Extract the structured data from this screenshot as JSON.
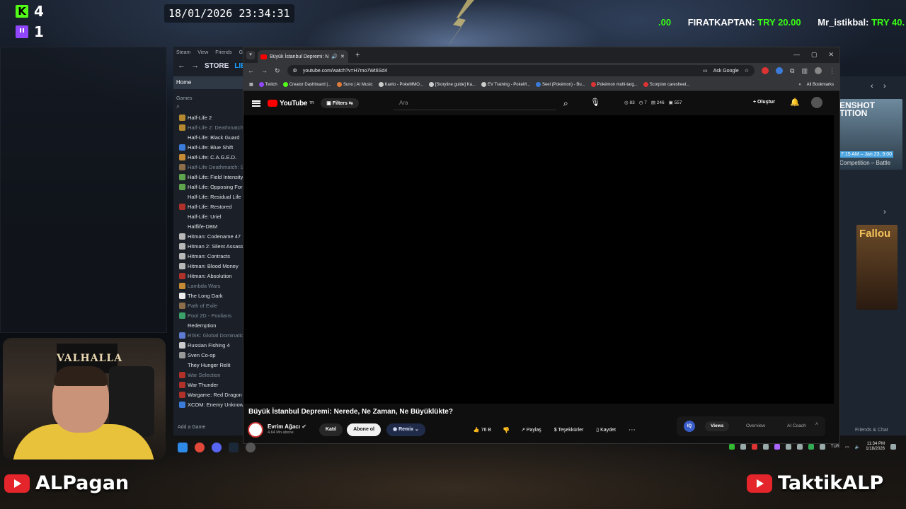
{
  "overlay": {
    "kick_count": "4",
    "twitch_count": "1",
    "clock": "18/01/2026 23:34:31",
    "ticker": [
      {
        "name": "",
        "amount": ".00"
      },
      {
        "name": "FIRATKAPTAN:",
        "amount": "TRY 20.00"
      },
      {
        "name": "Mr_istikbal:",
        "amount": "TRY 40."
      }
    ],
    "channel_left": "ALPagan",
    "channel_right": "TaktikALP",
    "webcam_wall_text": "VALHALLA"
  },
  "steam": {
    "menu": [
      "Steam",
      "View",
      "Friends",
      "G"
    ],
    "nav_store": "STORE",
    "nav_library": "LIBR",
    "home": "Home",
    "games_label": "Games",
    "search_glyph": "⌕",
    "games": [
      {
        "name": "Half-Life 2",
        "dim": false,
        "color": "#b5892f"
      },
      {
        "name": "Half-Life 2: Deathmatch",
        "dim": true,
        "color": "#b5892f"
      },
      {
        "name": "Half-Life: Black Guard",
        "dim": false,
        "color": "#1b2028"
      },
      {
        "name": "Half-Life: Blue Shift",
        "dim": false,
        "color": "#3b7bd9"
      },
      {
        "name": "Half-Life: C.A.G.E.D.",
        "dim": false,
        "color": "#c58a33"
      },
      {
        "name": "Half-Life Deathmatch: S",
        "dim": true,
        "color": "#8d6e4a"
      },
      {
        "name": "Half-Life: Field Intensity",
        "dim": false,
        "color": "#5fa54d"
      },
      {
        "name": "Half-Life: Opposing For",
        "dim": false,
        "color": "#5fa54d"
      },
      {
        "name": "Half-Life: Residual Life",
        "dim": false,
        "color": "#1b2028"
      },
      {
        "name": "Half-Life: Restored",
        "dim": false,
        "color": "#b0302a"
      },
      {
        "name": "Half-Life: Uriel",
        "dim": false,
        "color": "#1b2028"
      },
      {
        "name": "Halflife-DBM",
        "dim": false,
        "color": "#1b2028"
      },
      {
        "name": "Hitman: Codename 47",
        "dim": false,
        "color": "#b8b8b8"
      },
      {
        "name": "Hitman 2: Silent Assass",
        "dim": false,
        "color": "#b8b8b8"
      },
      {
        "name": "Hitman: Contracts",
        "dim": false,
        "color": "#b8b8b8"
      },
      {
        "name": "Hitman: Blood Money",
        "dim": false,
        "color": "#b8b8b8"
      },
      {
        "name": "Hitman: Absolution",
        "dim": false,
        "color": "#b0302a"
      },
      {
        "name": "Lambda Wars",
        "dim": true,
        "color": "#c58a33"
      },
      {
        "name": "The Long Dark",
        "dim": false,
        "color": "#eeeeee"
      },
      {
        "name": "Path of Exile",
        "dim": true,
        "color": "#8d6e4a"
      },
      {
        "name": "Pool 2D - Poolians",
        "dim": true,
        "color": "#3aa06a"
      },
      {
        "name": "Redemption",
        "dim": false,
        "color": "#1b2028"
      },
      {
        "name": "RISK: Global Domination",
        "dim": true,
        "color": "#5c7bd0"
      },
      {
        "name": "Russian Fishing 4",
        "dim": false,
        "color": "#cccccc"
      },
      {
        "name": "Sven Co-op",
        "dim": false,
        "color": "#999999"
      },
      {
        "name": "They Hunger Relit",
        "dim": false,
        "color": "#1b2028"
      },
      {
        "name": "War Selection",
        "dim": true,
        "color": "#b0302a"
      },
      {
        "name": "War Thunder",
        "dim": false,
        "color": "#b0302a"
      },
      {
        "name": "Wargame: Red Dragon",
        "dim": false,
        "color": "#b0302a"
      },
      {
        "name": "XCOM: Enemy Unknown",
        "dim": false,
        "color": "#3b7bd9"
      }
    ],
    "add_game": "Add a Game"
  },
  "store": {
    "card_title": "ENSHOT\nTITION",
    "card_time": "7:15 AM – Jan 23, 9:00",
    "card_sub": "Competition – Battle",
    "fallout": "Fallou",
    "friends_chat": "Friends & Chat"
  },
  "chrome": {
    "tab_title": "Büyük İstanbul Depremi: N",
    "url": "youtube.com/watch?v=H7mo7Wt6Sd4",
    "ask_google": "Ask Google",
    "bookmarks": [
      {
        "label": "Twitch",
        "color": "#9146ff"
      },
      {
        "label": "Creator Dashboard |...",
        "color": "#53fc18"
      },
      {
        "label": "Suno | AI Music",
        "color": "#e07b39"
      },
      {
        "label": "Kanto - PokeMMO...",
        "color": "#cccccc"
      },
      {
        "label": "[Storyline guide] Ka...",
        "color": "#cccccc"
      },
      {
        "label": "EV Training - PokeM...",
        "color": "#cccccc"
      },
      {
        "label": "Seel (Pokémon) - Bu...",
        "color": "#3b7bd9"
      },
      {
        "label": "Pokémon multi-targ...",
        "color": "#d33"
      },
      {
        "label": "Scorpion caresheet...",
        "color": "#d33"
      }
    ],
    "all_bookmarks": "All Bookmarks"
  },
  "youtube": {
    "logo": "YouTube",
    "region": "TR",
    "filters": "Filters",
    "search_placeholder": "Ara",
    "stats": [
      "83",
      "7",
      "246",
      "557"
    ],
    "create": "Oluştur",
    "video_title": "Büyük İstanbul Depremi: Nerede, Ne Zaman, Ne Büyüklükte?",
    "channel_name": "Evrim Ağacı",
    "subscribers": "4,64 Mn abone",
    "join": "Katıl",
    "subscribe": "Abone ol",
    "remix": "Remix",
    "likes": "76 B",
    "share": "Paylaş",
    "thanks": "Teşekkürler",
    "save": "Kaydet",
    "panel_iq": "IQ",
    "panel_tabs": [
      "Views",
      "Overview",
      "AI Coach"
    ]
  },
  "taskbar": {
    "lang": "TUR",
    "time": "11:34 PM",
    "date": "1/18/2026"
  }
}
